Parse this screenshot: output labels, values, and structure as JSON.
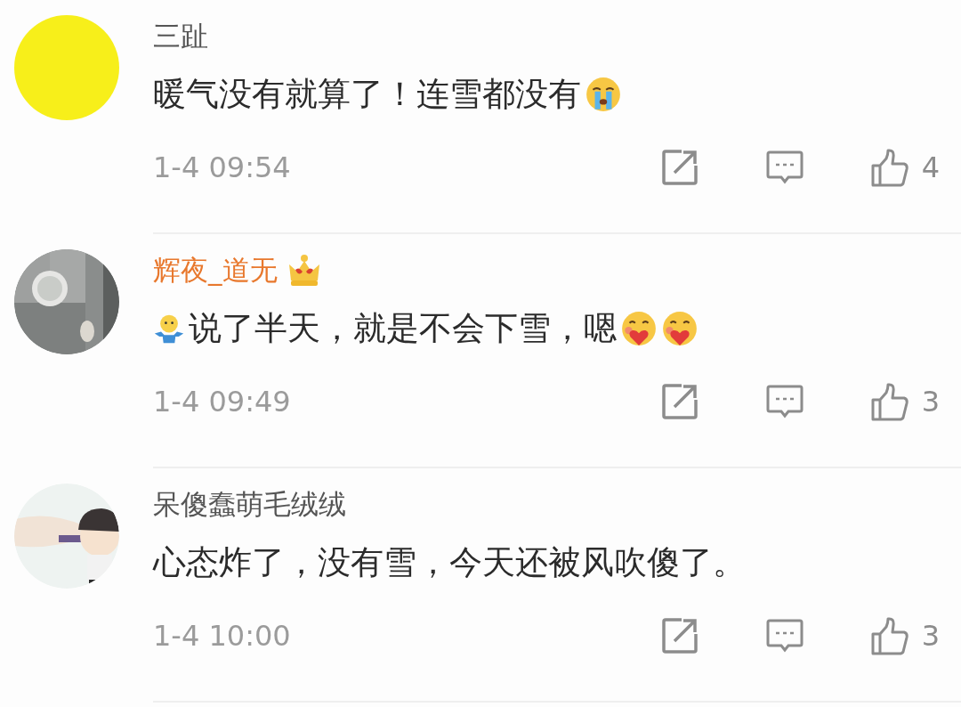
{
  "comments": [
    {
      "avatar": {
        "kind": "plain",
        "color": "#f7ef1a"
      },
      "name": "三趾",
      "vip": false,
      "body": [
        {
          "kind": "text",
          "text": "暖气没有就算了！连雪都没有"
        },
        {
          "kind": "cry"
        }
      ],
      "time": "1-4 09:54",
      "likes": "4"
    },
    {
      "avatar": {
        "kind": "picture"
      },
      "name": "辉夜_道无",
      "vip": true,
      "body": [
        {
          "kind": "shrug"
        },
        {
          "kind": "text",
          "text": "说了半天，就是不会下雪，嗯"
        },
        {
          "kind": "love"
        },
        {
          "kind": "love"
        }
      ],
      "time": "1-4 09:49",
      "likes": "3"
    },
    {
      "avatar": {
        "kind": "picture"
      },
      "name": "呆傻蠢萌毛绒绒",
      "vip": false,
      "body": [
        {
          "kind": "text",
          "text": "心态炸了，没有雪，今天还被风吹傻了。"
        }
      ],
      "time": "1-4 10:00",
      "likes": "3"
    }
  ]
}
